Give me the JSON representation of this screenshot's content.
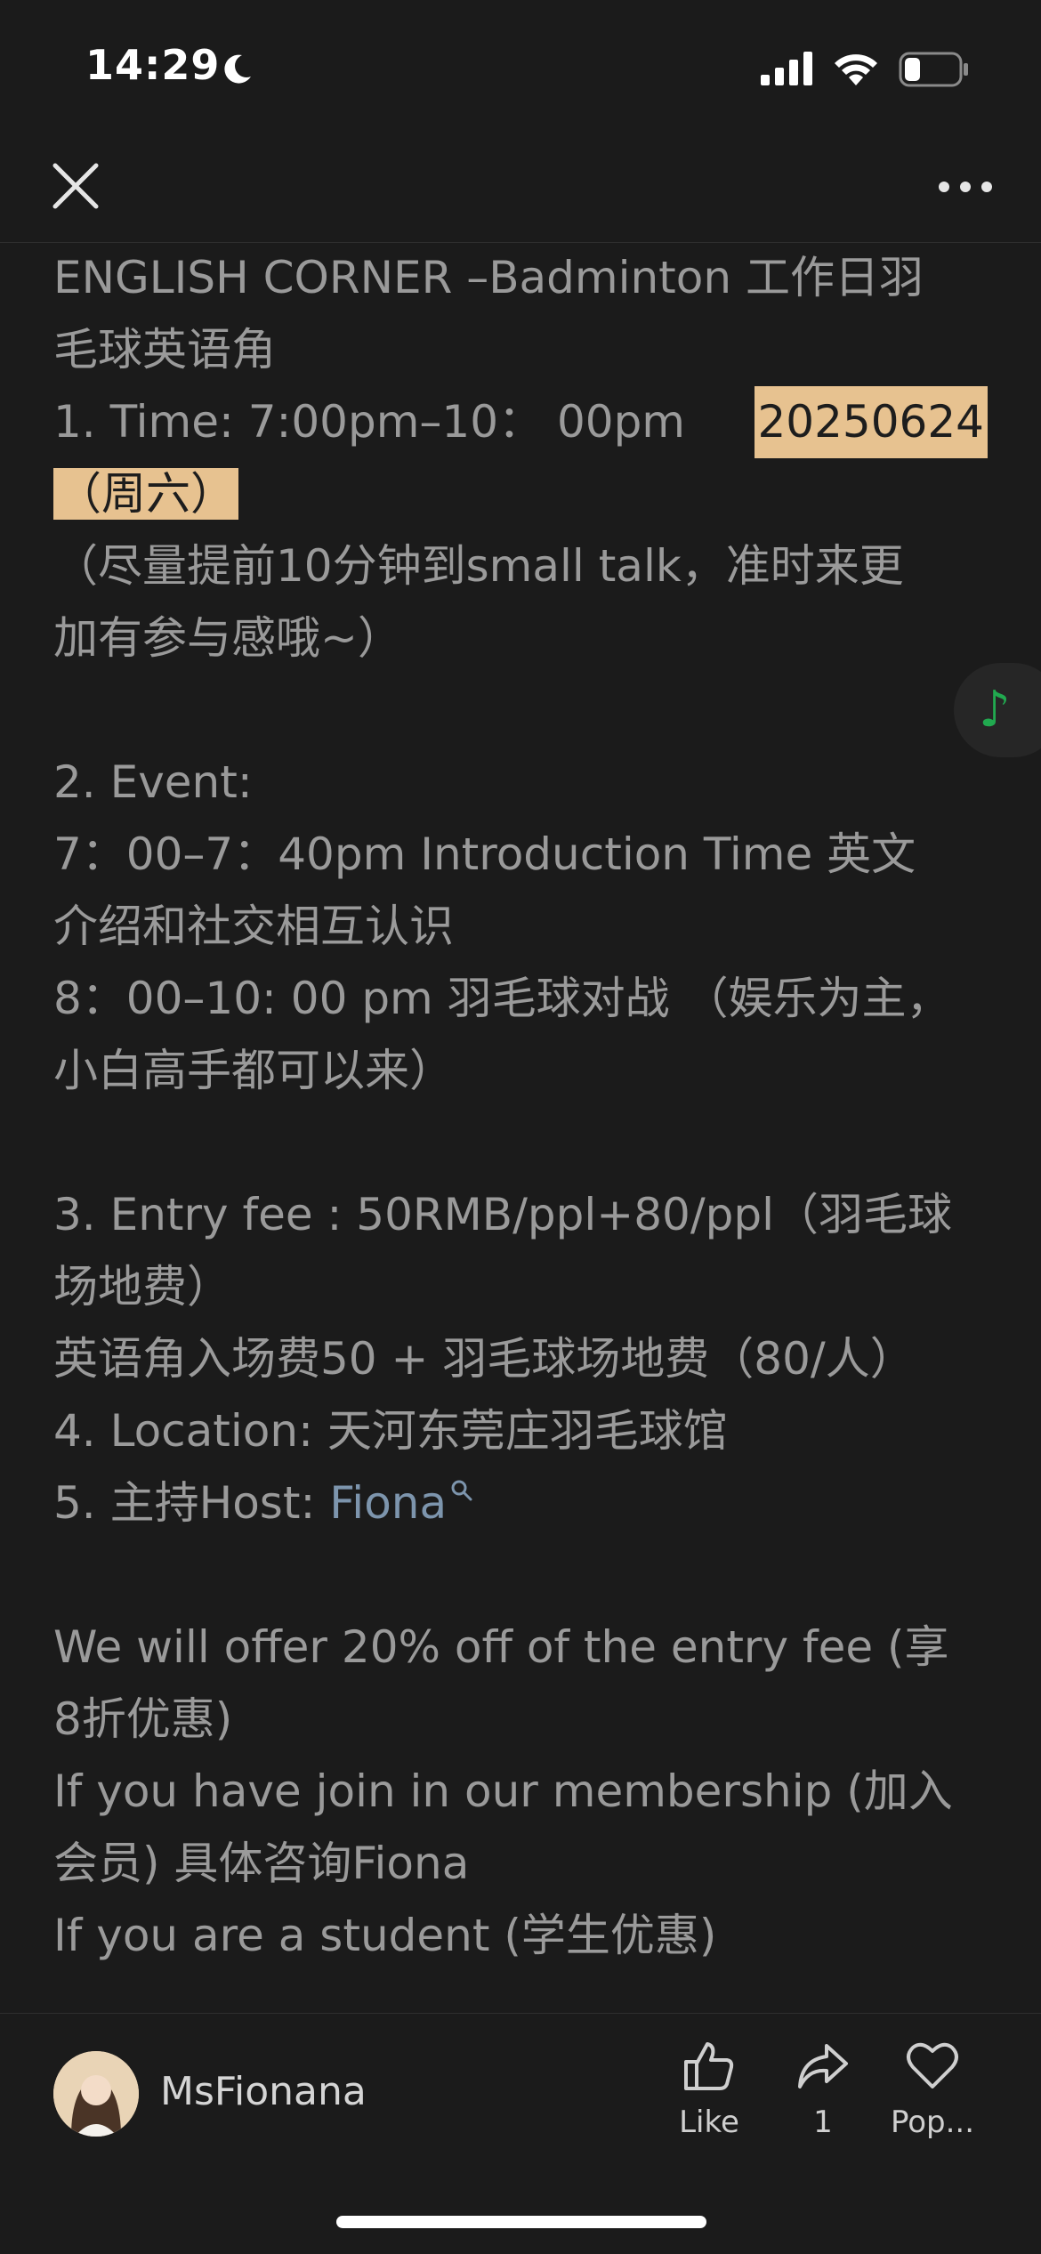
{
  "status_bar": {
    "time": "14:29",
    "moon_icon": "moon-icon",
    "signal_icon": "signal-icon",
    "wifi_icon": "wifi-icon",
    "battery_icon": "battery-icon",
    "battery_level": 0.3
  },
  "nav": {
    "close_icon": "close-icon",
    "more_icon": "more-icon"
  },
  "post": {
    "title_1": "ENGLISH CORNER –Badminton 工作日羽",
    "title_2": "毛球英语角",
    "time_label": "1. Time: 7:00pm–10： 00pm",
    "date_highlight": " 20250624",
    "weekday_highlight": "（周六）",
    "note_1": "（尽量提前10分钟到small talk，准时来更",
    "note_2": "加有参与感哦~）",
    "event_heading": "2. Event:",
    "event_1a": "7：00–7：40pm  Introduction Time 英文",
    "event_1b": "介绍和社交相互认识",
    "event_2a": "8：00–10: 00 pm 羽毛球对战 （娱乐为主，",
    "event_2b": "小白高手都可以来）",
    "fee_1": "3. Entry fee : 50RMB/ppl+80/ppl（羽毛球",
    "fee_2": "场地费）",
    "fee_3": "英语角入场费50 + 羽毛球场地费（80/人）",
    "location": "4. Location:  天河东莞庄羽毛球馆",
    "host_label": "5. 主持Host: ",
    "host_name": "Fiona",
    "host_search_icon": "search-icon",
    "offer_1": "We will offer 20% off of the entry fee (享",
    "offer_2": "8折优惠)",
    "member_1": "If you have join in our membership (加入",
    "member_2": "会员) 具体咨询Fiona",
    "student": "If you are a student (学生优惠)"
  },
  "music_button": {
    "icon": "music-note-icon",
    "glyph": "♪"
  },
  "bottom_bar": {
    "author_name": "MsFionana",
    "like_label": "Like",
    "share_count": "1",
    "popular_label": "Pop...",
    "like_icon": "thumbs-up-icon",
    "share_icon": "share-icon",
    "heart_icon": "heart-icon"
  },
  "colors": {
    "background": "#1b1b1b",
    "text": "#9a9a9a",
    "highlight": "#e7c290",
    "link": "#7d95ad",
    "music_green": "#21a94f"
  }
}
